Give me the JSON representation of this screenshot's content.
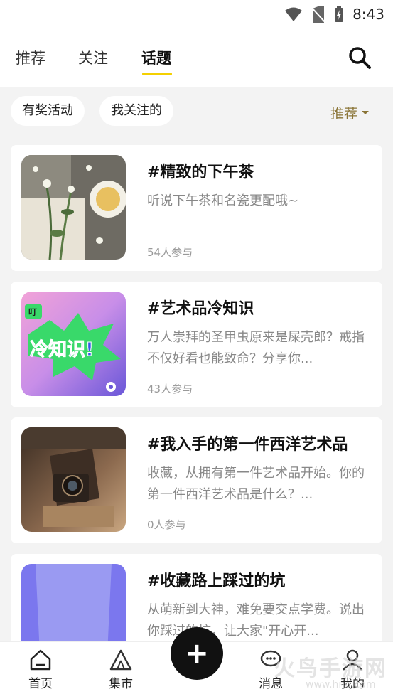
{
  "status_bar": {
    "time": "8:43"
  },
  "header": {
    "tabs": [
      {
        "label": "推荐",
        "active": false
      },
      {
        "label": "关注",
        "active": false
      },
      {
        "label": "话题",
        "active": true
      }
    ],
    "search_icon": "search-icon"
  },
  "filters": {
    "chips": [
      "有奖活动",
      "我关注的"
    ],
    "sort_label": "推荐"
  },
  "topics": [
    {
      "title": "#精致的下午茶",
      "desc": "听说下午茶和名瓷更配哦~",
      "count": "54人参与"
    },
    {
      "title": "#艺术品冷知识",
      "desc": "万人崇拜的圣甲虫原来是屎壳郎？戒指不仅好看也能致命？分享你...",
      "count": "43人参与",
      "thumb_text": "冷知识!",
      "badge": "叮"
    },
    {
      "title": "#我入手的第一件西洋艺术品",
      "desc": "收藏，从拥有第一件艺术品开始。你的第一件西洋艺术品是什么？...",
      "count": "0人参与"
    },
    {
      "title": "#收藏路上踩过的坑",
      "desc": "从萌新到大神，难免要交点学费。说出你踩过的坑，让大家\"开心开...",
      "count": ""
    }
  ],
  "bottom_nav": {
    "items": [
      {
        "label": "首页",
        "icon": "home-icon"
      },
      {
        "label": "集市",
        "icon": "tent-icon"
      },
      {
        "label": "消息",
        "icon": "message-icon"
      },
      {
        "label": "我的",
        "icon": "user-icon"
      }
    ],
    "fab_label": "+"
  },
  "watermark": {
    "text": "火鸟手游网",
    "url": "www.hnq.com"
  },
  "colors": {
    "accent": "#f4d000",
    "sort": "#8a7436",
    "fab": "#111111"
  }
}
